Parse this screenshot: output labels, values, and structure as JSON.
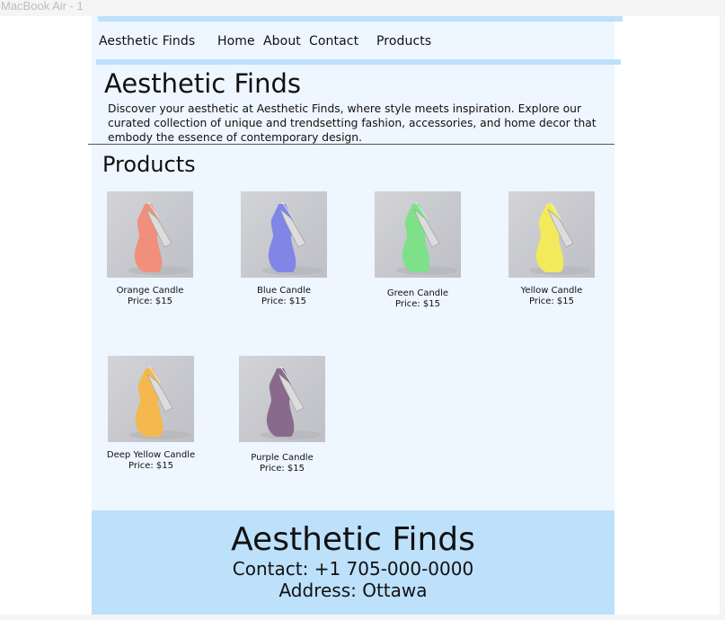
{
  "frame_label": "MacBook Air - 1",
  "nav": {
    "brand": "Aesthetic Finds",
    "links": [
      "Home",
      "About",
      "Contact",
      "Products"
    ]
  },
  "hero": {
    "title": "Aesthetic Finds",
    "description": "Discover your aesthetic at Aesthetic Finds, where style meets inspiration. Explore our curated collection of unique and trendsetting fashion, accessories, and home decor that embody the essence of contemporary design."
  },
  "products_section": {
    "title": "Products",
    "items": [
      {
        "name": "Orange Candle",
        "price": "Price: $15",
        "color": "#f0907a"
      },
      {
        "name": "Blue Candle",
        "price": "Price: $15",
        "color": "#7f86e6"
      },
      {
        "name": "Green Candle",
        "price": "Price: $15",
        "color": "#7fe08a"
      },
      {
        "name": "Yellow Candle",
        "price": "Price: $15",
        "color": "#f2ea5a"
      },
      {
        "name": "Deep Yellow Candle",
        "price": "Price: $15",
        "color": "#f4b84e"
      },
      {
        "name": "Purple Candle",
        "price": "Price: $15",
        "color": "#8a6a8c"
      }
    ]
  },
  "footer": {
    "title": "Aesthetic Finds",
    "contact": "Contact: +1 705-000-0000",
    "address": "Address: Ottawa"
  },
  "colors": {
    "accent_bar": "#bde0fb",
    "page_background": "#eef6ff"
  }
}
